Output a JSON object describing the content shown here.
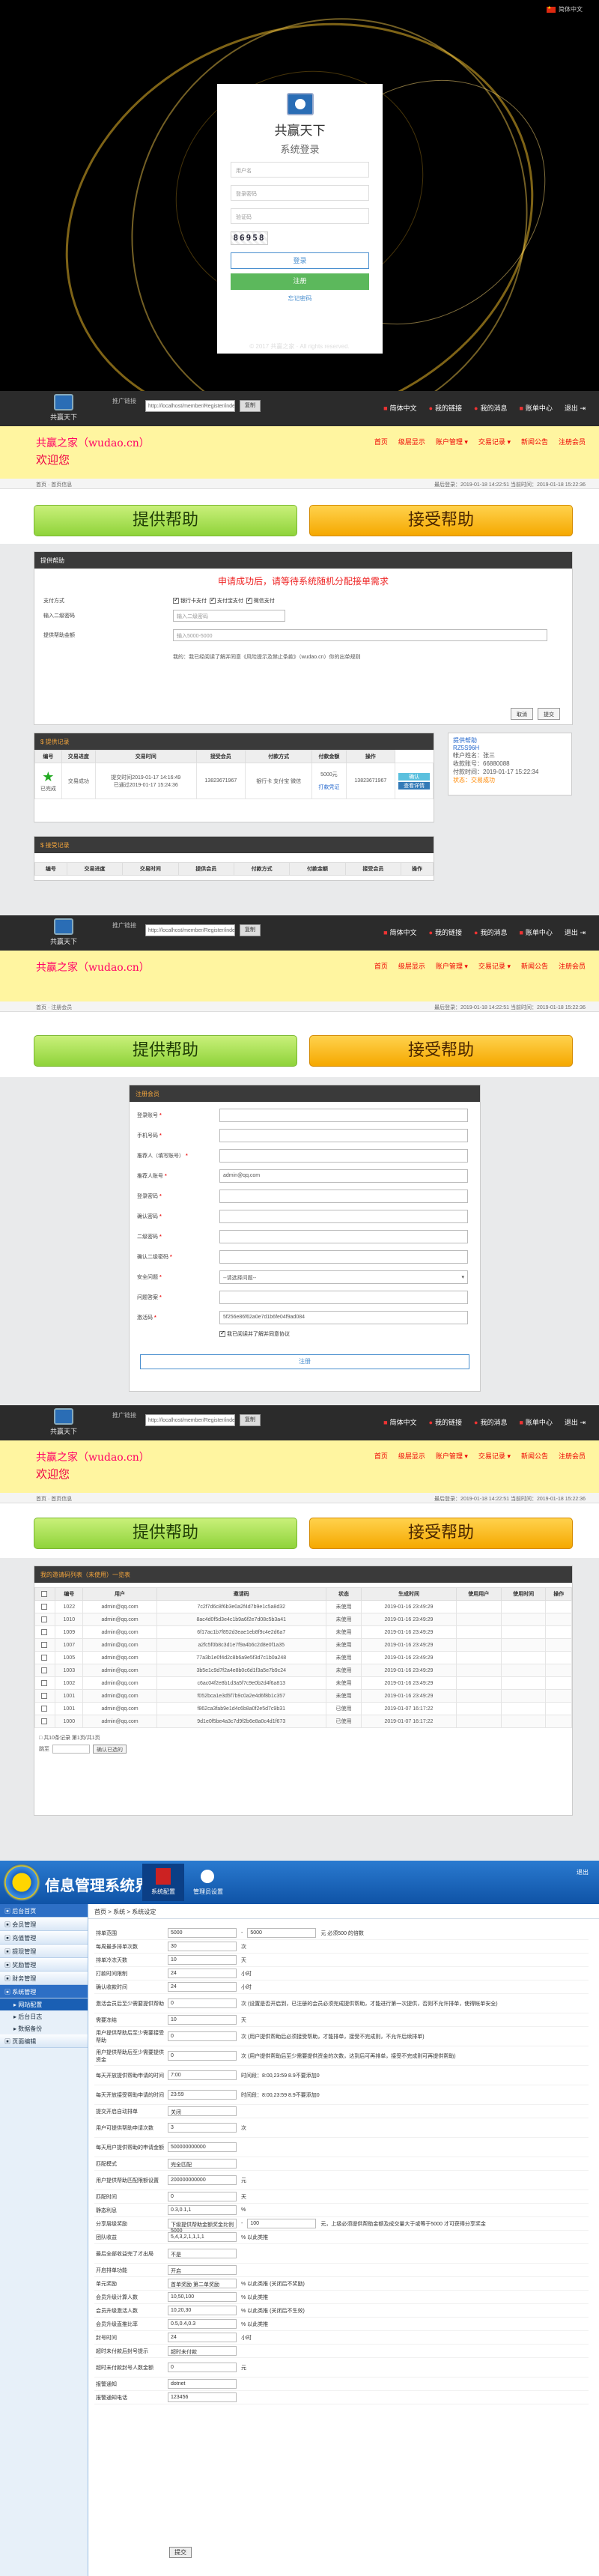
{
  "login": {
    "lang": "简体中文",
    "title": "共赢天下",
    "subtitle": "系统登录",
    "user_placeholder": "用户名",
    "pwd_placeholder": "登录密码",
    "captcha_placeholder": "验证码",
    "captcha_text": "86958",
    "login_btn": "登录",
    "register_btn": "注册",
    "forgot": "忘记密码",
    "copyright": "© 2017 共赢之家 · All rights reserved."
  },
  "header": {
    "logo_text": "共赢天下",
    "lang_label": "推广链接",
    "url": "http://localhost/member/Register/index",
    "copy_btn": "复制",
    "menu": [
      "简体中文",
      "我的链接",
      "我的消息",
      "账单中心",
      "退出"
    ]
  },
  "yellow": {
    "brand": "共赢之家（wudao.cn）",
    "welcome": "欢迎您",
    "nav": [
      "首页",
      "级层显示",
      "账户管理",
      "交易记录",
      "新闻公告",
      "注册会员"
    ]
  },
  "subnav": {
    "breadcrumb": "首页 · 首页信息",
    "time": "最后登录：2019-01-18 14:22:51  当前时间：2019-01-18 15:22:36"
  },
  "big_buttons": {
    "provide": "提供帮助",
    "accept": "接受帮助"
  },
  "provide_panel": {
    "header": "提供帮助",
    "title": "申请成功后，请等待系统随机分配接单需求",
    "rows": [
      {
        "label": "支付方式",
        "value": ""
      },
      {
        "label": "输入二级密码",
        "value": "输入二级密码"
      },
      {
        "label": "提供帮助金额",
        "value": "输入5000-5000"
      }
    ],
    "pay_options": [
      "银行卡支付",
      "支付宝支付",
      "微信支付"
    ],
    "agree": "我的：我已经阅读了解并同意《风险提示及禁止条款》（wudao.cn）你的出单规则",
    "cancel": "取消",
    "submit": "提交"
  },
  "provide_record": {
    "header": "提供记录",
    "columns": [
      "编号",
      "交易进度",
      "交易时间",
      "接受会员",
      "付款方式",
      "付款金额",
      "操作"
    ],
    "row": {
      "status": "交易成功",
      "progress": "已完成",
      "time1": "提交时间2019-01-17 14:16:49",
      "time2": "已通过2019-01-17 15:24:36",
      "member": "13823671967",
      "pay": "银行卡 支付宝 微信",
      "amount": "5000元",
      "amount2": "打款凭证",
      "actions": [
        "确认",
        "查看详情"
      ]
    }
  },
  "receive_record": {
    "header": "接受记录",
    "columns": [
      "编号",
      "交易进度",
      "交易时间",
      "提供会员",
      "付款方式",
      "付款金额",
      "接受会员",
      "操作"
    ]
  },
  "side_card": {
    "title": "提供帮助",
    "code": "RZ5S96H",
    "lines": [
      "帐户姓名：张三",
      "收款账号：66880088",
      "付款时间：2019-01-17 15:22:34",
      "状态：交易成功"
    ]
  },
  "register": {
    "header": "注册会员",
    "fields": [
      {
        "label": "登录账号",
        "value": ""
      },
      {
        "label": "手机号码",
        "value": ""
      },
      {
        "label": "推荐人（填写账号）",
        "value": ""
      },
      {
        "label": "推荐人账号",
        "value": "admin@qq.com"
      },
      {
        "label": "登录密码",
        "value": ""
      },
      {
        "label": "确认密码",
        "value": ""
      },
      {
        "label": "二级密码",
        "value": ""
      },
      {
        "label": "确认二级密码",
        "value": ""
      },
      {
        "label": "安全问题",
        "value": "--请选择问题--"
      },
      {
        "label": "问题答案",
        "value": ""
      },
      {
        "label": "激活码",
        "value": "5f256e86f62a0e7d1b6fe04f9ad084"
      }
    ],
    "agree": "我已阅读并了解并同意协议",
    "submit": "注册"
  },
  "invite": {
    "header": "我的邀请码列表（未使用）一览表",
    "columns": [
      "",
      "编号",
      "用户",
      "邀请码",
      "状态",
      "生成时间",
      "使用用户",
      "使用时间",
      "操作"
    ],
    "rows": [
      [
        "1022",
        "admin@qq.com",
        "7c2f7d6c8f6b3e0a2f4d7b9e1c5a8d32",
        "未使用",
        "2019-01-16 23:49:29"
      ],
      [
        "1010",
        "admin@qq.com",
        "8ac4d0f5d3e4c1b9a6f2e7d08c5b3a41",
        "未使用",
        "2019-01-16 23:49:29"
      ],
      [
        "1009",
        "admin@qq.com",
        "6f17ac1b7f852d3eae1eb8f9c4e2d6a7",
        "未使用",
        "2019-01-16 23:49:29"
      ],
      [
        "1007",
        "admin@qq.com",
        "a2fc5f0b8c3d1e7f9a4b6c2d8e0f1a35",
        "未使用",
        "2019-01-16 23:49:29"
      ],
      [
        "1005",
        "admin@qq.com",
        "77a3b1e0f4d2c8b6a9e5f3d7c1b0a248",
        "未使用",
        "2019-01-16 23:49:29"
      ],
      [
        "1003",
        "admin@qq.com",
        "3b5e1c9d7f2a4e8b0c6d1f3a5e7b9c24",
        "未使用",
        "2019-01-16 23:49:29"
      ],
      [
        "1002",
        "admin@qq.com",
        "c6ac04f2e8b1d3a5f7c9e0b2d4f6a813",
        "未使用",
        "2019-01-16 23:49:29"
      ],
      [
        "1001",
        "admin@qq.com",
        "f052bca1e3d5f7b9c0a2e4d6f8b1c357",
        "未使用",
        "2019-01-16 23:49:29"
      ],
      [
        "1001",
        "admin@qq.com",
        "f862ca3fab9e1d4c6b8a0f2e5d7c9b31",
        "已使用",
        "2019-01-07 16:17:22"
      ],
      [
        "1000",
        "admin@qq.com",
        "9d1e0f5be4a3c7d9f2b6e8a0c4d1f673",
        "已使用",
        "2019-01-07 16:17:22"
      ]
    ],
    "pager": "共10条记录 第1页/共1页",
    "goto_label": "跳至",
    "goto_placeholder": "确认已选的"
  },
  "admin": {
    "title": "信息管理系统界面",
    "tabs": [
      "系统配置",
      "管理员设置"
    ],
    "exit": "退出",
    "sidebar": [
      {
        "label": "后台首页",
        "open": true
      },
      {
        "label": "会员管理"
      },
      {
        "label": "充值管理"
      },
      {
        "label": "提现管理"
      },
      {
        "label": "奖励管理"
      },
      {
        "label": "财务管理"
      },
      {
        "label": "系统管理",
        "open": true
      },
      {
        "label": "网站配置",
        "sub": true,
        "active": true
      },
      {
        "label": "后台日志",
        "sub": true
      },
      {
        "label": "数据备份",
        "sub": true
      },
      {
        "label": "页面编辑"
      }
    ],
    "breadcrumb": "首页 > 系统 > 系统设定",
    "rows": [
      {
        "label": "排单范围",
        "value": "5000",
        "value2": "5000",
        "hint": "元 必须500 的倍数"
      },
      {
        "label": "每周最多排单次数",
        "value": "30",
        "hint": "次"
      },
      {
        "label": "排单冷冻天数",
        "value": "10",
        "hint": "天"
      },
      {
        "label": "打款时间限制",
        "value": "24",
        "hint": "小时"
      },
      {
        "label": "确认收款时间",
        "value": "24",
        "hint": "小时"
      },
      {
        "label": "激活会员后至少需要提供帮助",
        "value": "0",
        "hint": "次 (设置是否开启到，已注册的会员必须完成提供帮助，才能进行第一次提供，否则不允许排单，使得帐单安全)"
      },
      {
        "label": "需要冻结",
        "value": "10",
        "hint": "天"
      },
      {
        "label": "用户提供帮助后至少需要接受帮助",
        "value": "0",
        "hint": "次 (用户提供帮助后必须接受帮助，才能排单，接受不完成则，不允许后续排单)"
      },
      {
        "label": "用户提供帮助后至少需要提供资金",
        "value": "0",
        "hint": "次 (用户提供帮助后至少需要提供资金的次数，达到后可再排单，接受不完成则可再提供帮助)"
      },
      {
        "label": "每天开放提供帮助申请的时间",
        "value": "7:00",
        "hint": "时间段：8:00,23:59 8.9不要添加0"
      },
      {
        "label": "每天开放接受帮助申请的时间",
        "value": "23:59",
        "hint": "时间段：8:00,23:59 8.9不要添加0"
      },
      {
        "label": "提交开启自动排单",
        "value": "关闭",
        "hint": ""
      },
      {
        "label": "用户可提供帮助申请次数",
        "value": "3",
        "hint": "次"
      },
      {
        "label": "每天用户提供帮助的申请金额",
        "value": "500000000000",
        "hint": ""
      },
      {
        "label": "匹配模式",
        "value": "完全匹配",
        "hint": ""
      },
      {
        "label": "用户提供帮助匹配限额设置",
        "value": "200000000000",
        "hint": "元"
      },
      {
        "label": "匹配时间",
        "value": "0",
        "hint": "天"
      },
      {
        "label": "静态利息",
        "value": "0.3,0.1,1",
        "hint": "%"
      },
      {
        "label": "分享层级奖励",
        "value": "下级提供帮助金额奖金比例5000",
        "value2": "100",
        "hint": "元，上级必须提供帮助金额及成交量大于或等于5000 才可获得分享奖金"
      },
      {
        "label": "团队收益",
        "value": "5,4,3,2,1,1,1,1",
        "hint": "% 以此类推"
      },
      {
        "label": "最后全部收益完了才出局",
        "value": "不是",
        "hint": ""
      },
      {
        "label": "开启排单功能",
        "value": "开启",
        "hint": ""
      },
      {
        "label": "单元奖励",
        "value": "首单奖励 第二单奖励 ",
        "hint": "% 以此类推 (关闭后不奖励)"
      },
      {
        "label": "会员升级计算人数",
        "value": "10,50,100",
        "hint": "% 以此类推"
      },
      {
        "label": "会员升级激活人数",
        "value": "10,20,30",
        "hint": "% 以此类推 (关闭后不生效)"
      },
      {
        "label": "会员升级直推比率",
        "value": "0.5,0.4,0.3",
        "hint": "% 以此类推"
      },
      {
        "label": "封号时间",
        "value": "24",
        "hint": "小时"
      },
      {
        "label": "超时未付款后封号提示",
        "value": "超时未付款",
        "hint": ""
      },
      {
        "label": "超时未付款封号人数金额",
        "value": "0",
        "hint": "元"
      },
      {
        "label": "报警通知",
        "value": "dotnet",
        "hint": ""
      },
      {
        "label": "报警通知电话",
        "value": "123456",
        "hint": ""
      }
    ],
    "save": "提交"
  }
}
